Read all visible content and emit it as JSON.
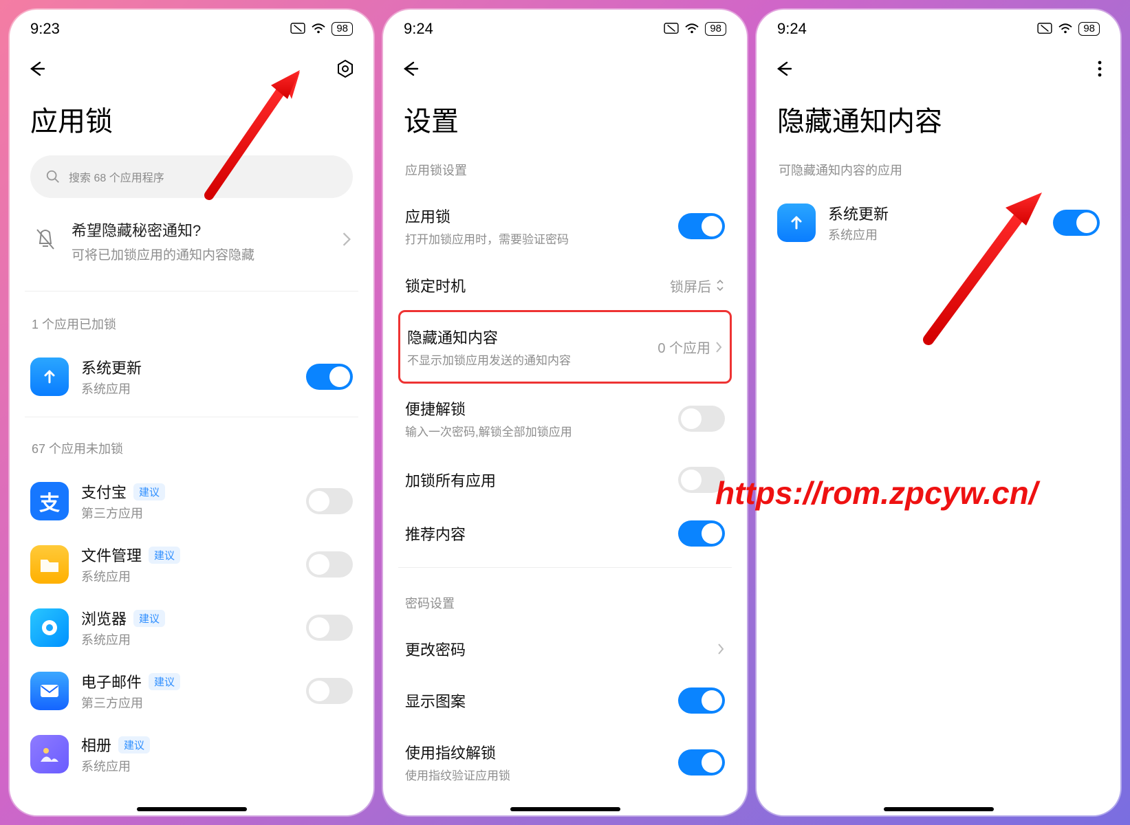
{
  "watermark": "https://rom.zpcyw.cn/",
  "phone1": {
    "time": "9:23",
    "battery": "98",
    "title": "应用锁",
    "search_placeholder": "搜索 68 个应用程序",
    "notice_title": "希望隐藏秘密通知?",
    "notice_sub": "可将已加锁应用的通知内容隐藏",
    "locked_label": "1 个应用已加锁",
    "unlocked_label": "67 个应用未加锁",
    "badge": "建议",
    "apps_locked": [
      {
        "name": "系统更新",
        "sub": "系统应用"
      }
    ],
    "apps_unlocked": [
      {
        "name": "支付宝",
        "sub": "第三方应用"
      },
      {
        "name": "文件管理",
        "sub": "系统应用"
      },
      {
        "name": "浏览器",
        "sub": "系统应用"
      },
      {
        "name": "电子邮件",
        "sub": "第三方应用"
      },
      {
        "name": "相册",
        "sub": "系统应用"
      }
    ]
  },
  "phone2": {
    "time": "9:24",
    "battery": "98",
    "title": "设置",
    "section1": "应用锁设置",
    "section2": "密码设置",
    "rows": {
      "applock": {
        "title": "应用锁",
        "sub": "打开加锁应用时，需要验证密码"
      },
      "locktime": {
        "title": "锁定时机",
        "value": "锁屏后"
      },
      "hide": {
        "title": "隐藏通知内容",
        "sub": "不显示加锁应用发送的通知内容",
        "value": "0 个应用"
      },
      "quickunlock": {
        "title": "便捷解锁",
        "sub": "输入一次密码,解锁全部加锁应用"
      },
      "lockall": {
        "title": "加锁所有应用"
      },
      "recommend": {
        "title": "推荐内容"
      },
      "changepwd": {
        "title": "更改密码"
      },
      "showpattern": {
        "title": "显示图案"
      },
      "fingerprint": {
        "title": "使用指纹解锁",
        "sub": "使用指纹验证应用锁"
      }
    }
  },
  "phone3": {
    "time": "9:24",
    "battery": "98",
    "title": "隐藏通知内容",
    "section": "可隐藏通知内容的应用",
    "app": {
      "name": "系统更新",
      "sub": "系统应用"
    }
  }
}
